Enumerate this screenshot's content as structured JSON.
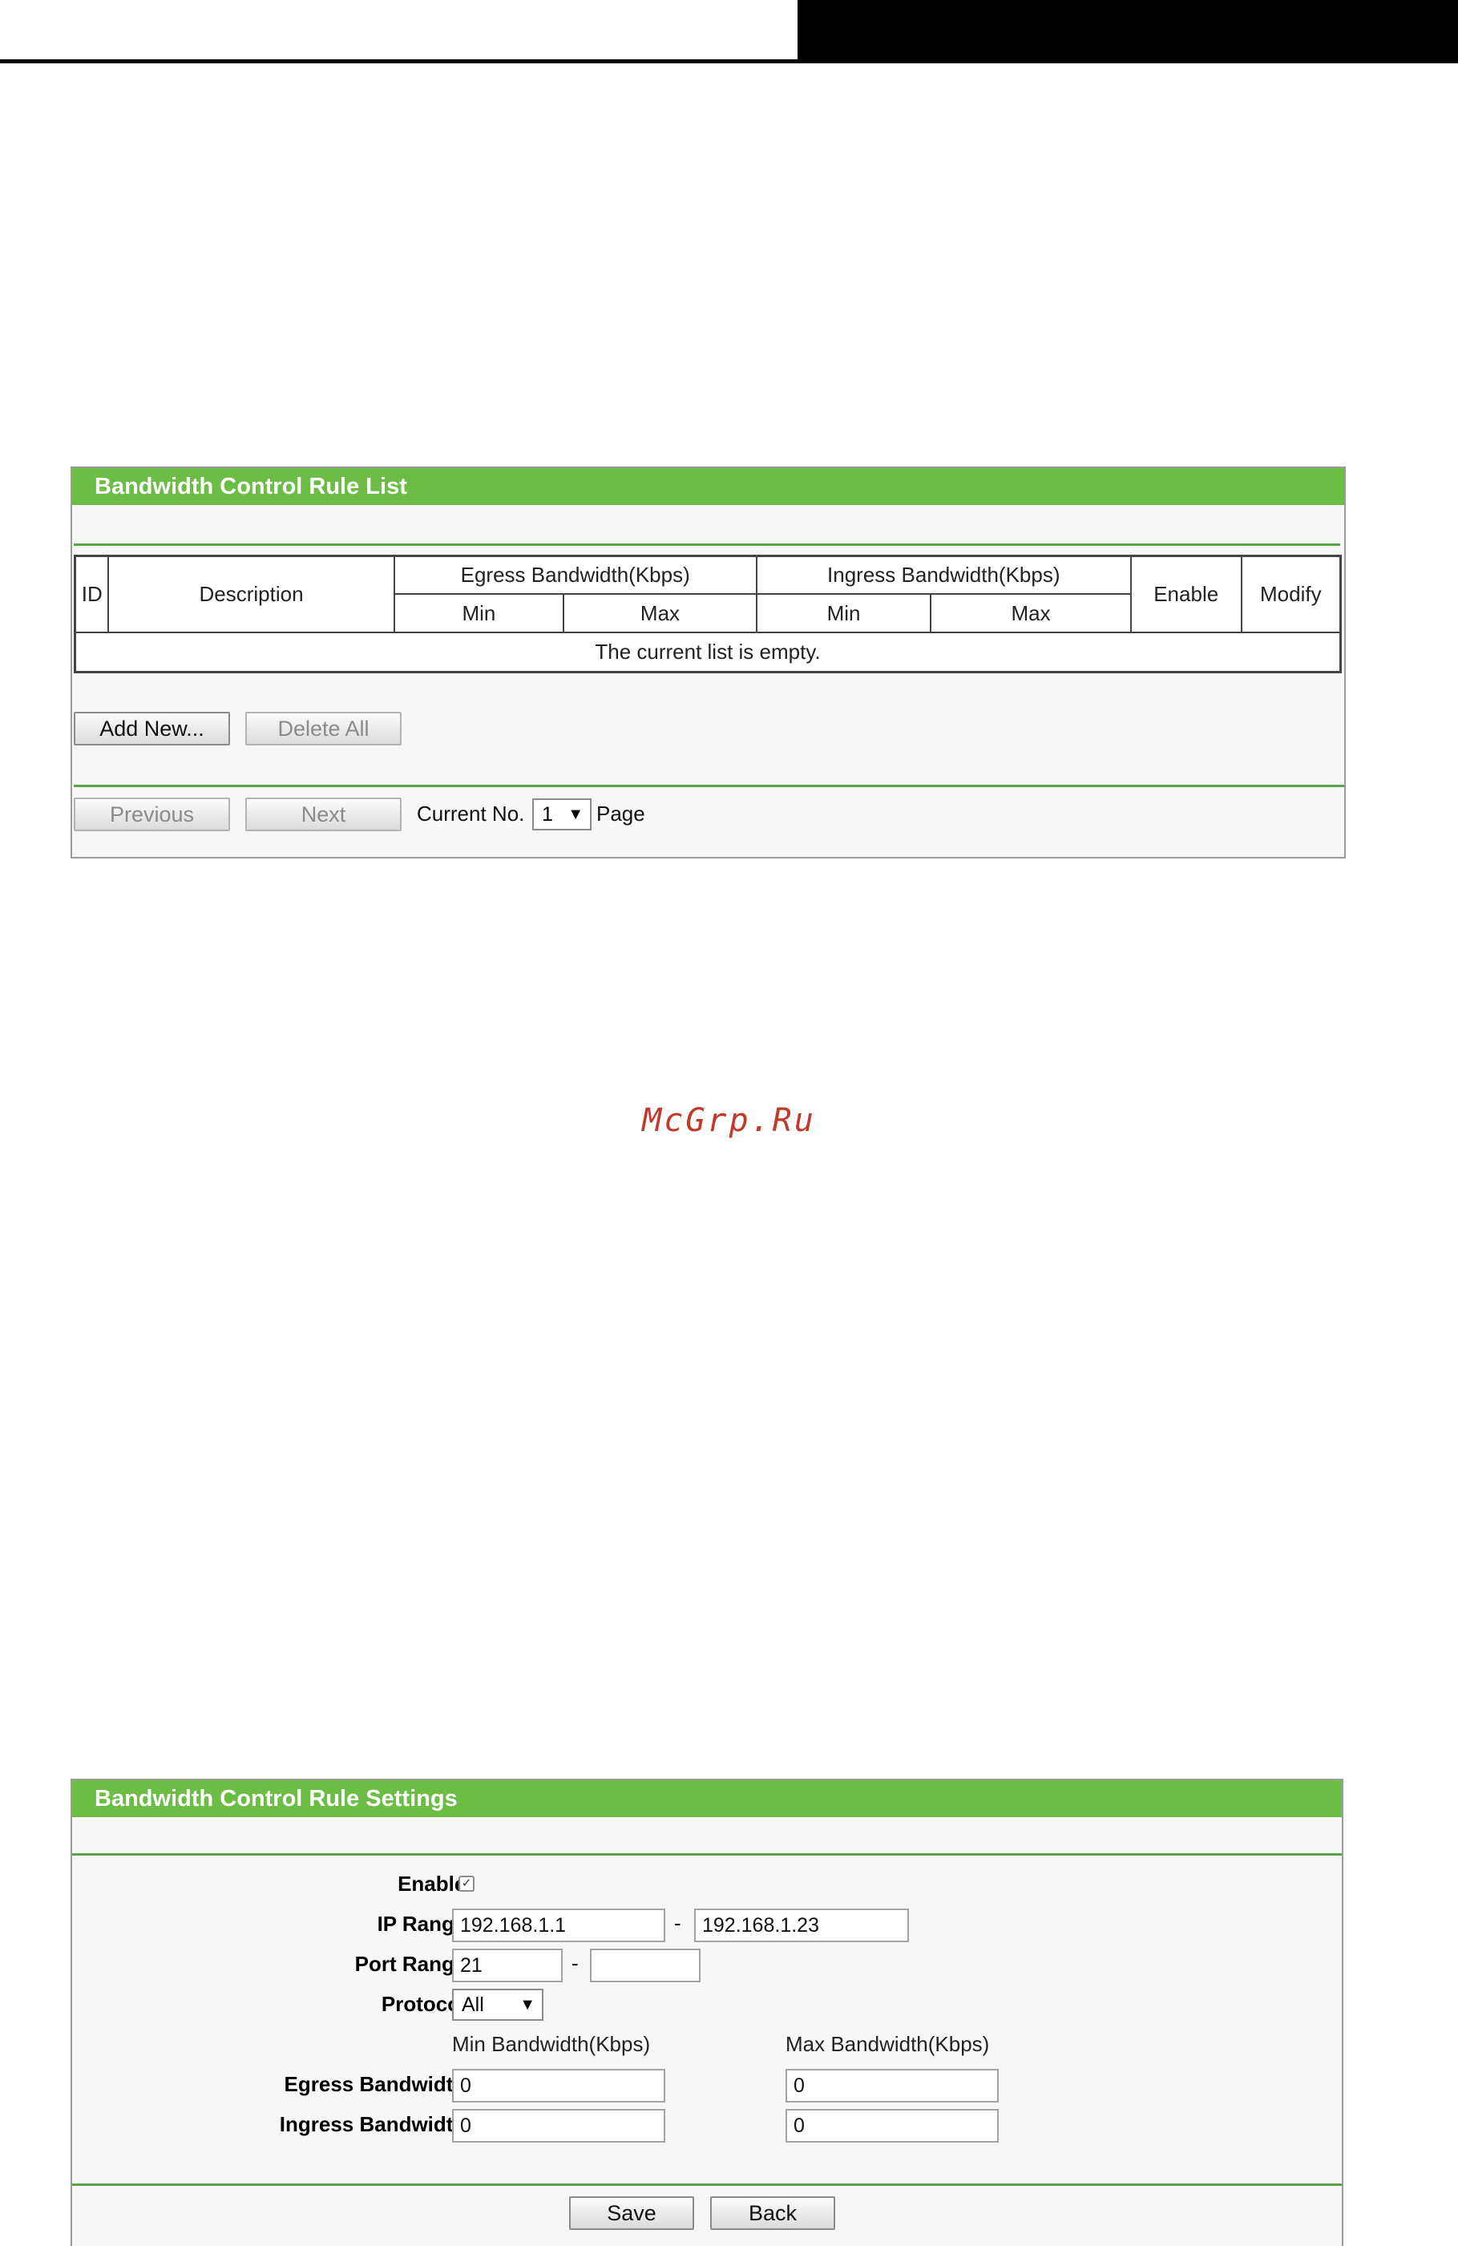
{
  "rule_list": {
    "title": "Bandwidth Control Rule List",
    "headers": {
      "id": "ID",
      "description": "Description",
      "egress": "Egress Bandwidth(Kbps)",
      "ingress": "Ingress Bandwidth(Kbps)",
      "enable": "Enable",
      "modify": "Modify",
      "min": "Min",
      "max": "Max"
    },
    "empty_message": "The current list is empty.",
    "add_new_label": "Add New...",
    "delete_all_label": "Delete All",
    "previous_label": "Previous",
    "next_label": "Next",
    "current_no_label": "Current No.",
    "current_page_value": "1",
    "page_label": "Page"
  },
  "watermark": "McGrp.Ru",
  "settings": {
    "title": "Bandwidth Control Rule Settings",
    "enable_label": "Enable:",
    "enable_checked": true,
    "ip_range_label": "IP Range:",
    "ip_start": "192.168.1.1",
    "ip_end": "192.168.1.23",
    "port_range_label": "Port Range:",
    "port_start": "21",
    "port_end": "",
    "protocol_label": "Protocol:",
    "protocol_value": "All",
    "min_bw_header": "Min Bandwidth(Kbps)",
    "max_bw_header": "Max Bandwidth(Kbps)",
    "egress_label": "Egress Bandwidth:",
    "egress_min": "0",
    "egress_max": "0",
    "ingress_label": "Ingress Bandwidth:",
    "ingress_min": "0",
    "ingress_max": "0",
    "range_separator": "-",
    "save_label": "Save",
    "back_label": "Back"
  },
  "colors": {
    "title_bar": "#6cbd45",
    "rule_line": "#5aa54a",
    "watermark": "#c0392b"
  }
}
